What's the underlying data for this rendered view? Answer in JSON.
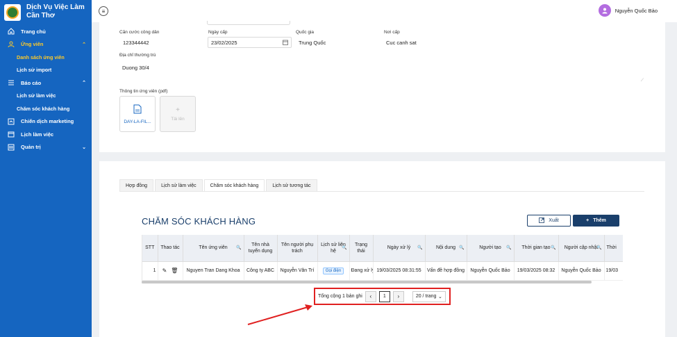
{
  "brand": {
    "title": "Dịch Vụ Việc Làm Cần Thơ"
  },
  "sidebar": {
    "items": [
      {
        "label": "Trang chủ",
        "icon": "home-icon"
      },
      {
        "label": "Ứng viên",
        "icon": "user-icon",
        "expanded": true,
        "active": true
      },
      {
        "label": "Danh sách ứng viên",
        "sub": true,
        "active": true
      },
      {
        "label": "Lịch sử import",
        "sub": true
      },
      {
        "label": "Báo cáo",
        "icon": "list-icon",
        "expanded": true
      },
      {
        "label": "Lịch sử làm việc",
        "sub": true
      },
      {
        "label": "Chăm sóc khách hàng",
        "sub": true
      },
      {
        "label": "Chiến dịch marketing",
        "icon": "campaign-icon"
      },
      {
        "label": "Lịch làm việc",
        "icon": "calendar-icon"
      },
      {
        "label": "Quản trị",
        "icon": "admin-icon",
        "collapsed": true
      }
    ]
  },
  "header": {
    "user_name": "Nguyễn Quốc Bảo"
  },
  "form": {
    "id_label": "Căn cước công dân",
    "id_value": "123344442",
    "issue_date_label": "Ngày cấp",
    "issue_date_value": "23/02/2025",
    "country_label": "Quốc gia",
    "country_value": "Trung Quốc",
    "place_label": "Nơi cấp",
    "place_value": "Cuc canh sat",
    "address_label": "Địa chỉ thường trú",
    "address_value": "Duong 30/4",
    "cv_label": "Thông tin ứng viên (pdf)",
    "file_name": "DAY-LA-FIL...",
    "upload_label": "Tải lên"
  },
  "tabs": [
    "Hợp đồng",
    "Lịch sử làm việc",
    "Chăm sóc khách hàng",
    "Lịch sử tương tác"
  ],
  "active_tab": 2,
  "section": {
    "title": "CHĂM SÓC KHÁCH HÀNG",
    "export_label": "Xuất",
    "add_label": "Thêm"
  },
  "table": {
    "columns": [
      "STT",
      "Thao tác",
      "Tên ứng viên",
      "Tên nhà tuyển dụng",
      "Tên người phụ trách",
      "Lịch sử liên hệ",
      "Trạng thái",
      "Ngày xử lý",
      "Nội dung",
      "Người tạo",
      "Thời gian tạo",
      "Người cập nhật",
      "Thời"
    ],
    "rows": [
      {
        "stt": "1",
        "candidate": "Nguyen Tran Dang Khoa",
        "employer": "Công ty ABC",
        "manager": "Nguyễn Văn Trí",
        "contact": "Gọi điện",
        "status": "Đang xử lý",
        "process_date": "19/03/2025 08:31:55",
        "content": "Vấn đề hợp đồng",
        "creator": "Nguyễn Quốc Bảo",
        "created_at": "19/03/2025 08:32",
        "updater": "Nguyễn Quốc Bảo",
        "updated_at": "19/03"
      }
    ]
  },
  "pagination": {
    "total_text": "Tổng cộng 1 bản ghi",
    "current_page": "1",
    "page_size": "20 / trang"
  },
  "colors": {
    "sidebar_bg": "#1565c0",
    "active_text": "#ffca28",
    "title_color": "#1a3f6b",
    "highlight": "#e02020"
  }
}
